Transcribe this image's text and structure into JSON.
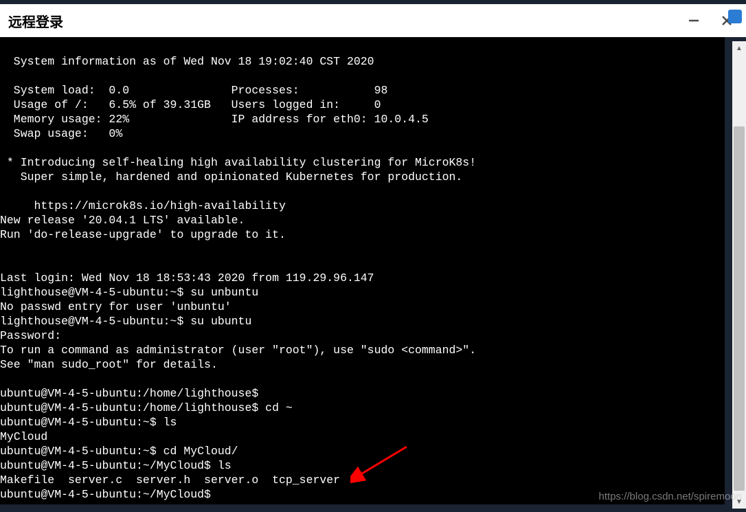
{
  "window": {
    "title": "远程登录"
  },
  "terminal": {
    "lines": [
      "",
      "  System information as of Wed Nov 18 19:02:40 CST 2020",
      "",
      "  System load:  0.0               Processes:           98",
      "  Usage of /:   6.5% of 39.31GB   Users logged in:     0",
      "  Memory usage: 22%               IP address for eth0: 10.0.4.5",
      "  Swap usage:   0%",
      "",
      " * Introducing self-healing high availability clustering for MicroK8s!",
      "   Super simple, hardened and opinionated Kubernetes for production.",
      "",
      "     https://microk8s.io/high-availability",
      "New release '20.04.1 LTS' available.",
      "Run 'do-release-upgrade' to upgrade to it.",
      "",
      "",
      "Last login: Wed Nov 18 18:53:43 2020 from 119.29.96.147",
      "lighthouse@VM-4-5-ubuntu:~$ su unbuntu",
      "No passwd entry for user 'unbuntu'",
      "lighthouse@VM-4-5-ubuntu:~$ su ubuntu",
      "Password:",
      "To run a command as administrator (user \"root\"), use \"sudo <command>\".",
      "See \"man sudo_root\" for details.",
      "",
      "ubuntu@VM-4-5-ubuntu:/home/lighthouse$",
      "ubuntu@VM-4-5-ubuntu:/home/lighthouse$ cd ~",
      "ubuntu@VM-4-5-ubuntu:~$ ls",
      "MyCloud",
      "ubuntu@VM-4-5-ubuntu:~$ cd MyCloud/",
      "ubuntu@VM-4-5-ubuntu:~/MyCloud$ ls",
      "Makefile  server.c  server.h  server.o  tcp_server",
      "ubuntu@VM-4-5-ubuntu:~/MyCloud$"
    ]
  },
  "watermark": "https://blog.csdn.net/spiremoon"
}
